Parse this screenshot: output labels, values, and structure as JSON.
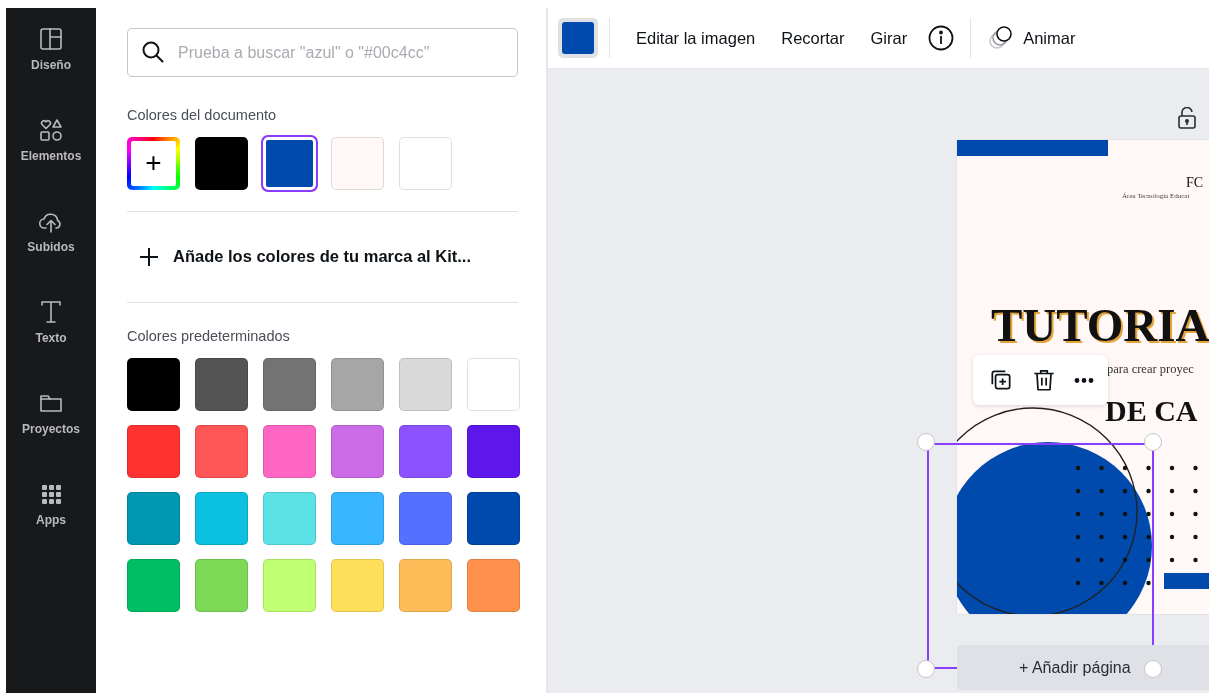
{
  "sidebar": {
    "items": [
      {
        "label": "Diseño"
      },
      {
        "label": "Elementos"
      },
      {
        "label": "Subidos"
      },
      {
        "label": "Texto"
      },
      {
        "label": "Proyectos"
      },
      {
        "label": "Apps"
      }
    ]
  },
  "panel": {
    "search": {
      "placeholder": "Prueba a buscar \"azul\" o \"#00c4cc\""
    },
    "document_colors": {
      "title": "Colores del documento",
      "swatches": [
        {
          "kind": "add",
          "label": "+"
        },
        {
          "kind": "color",
          "color": "#000000",
          "selected": false
        },
        {
          "kind": "color",
          "color": "#004aad",
          "selected": true
        },
        {
          "kind": "color",
          "color": "#fff8f7",
          "selected": false
        },
        {
          "kind": "color",
          "color": "#ffffff",
          "selected": false
        }
      ]
    },
    "brand_link": "Añade los colores de tu marca al Kit...",
    "default_colors": {
      "title": "Colores predeterminados",
      "swatches": [
        {
          "color": "#000000"
        },
        {
          "color": "#545454"
        },
        {
          "color": "#737373"
        },
        {
          "color": "#a6a6a6"
        },
        {
          "color": "#d9d9d9"
        },
        {
          "color": "#ffffff"
        },
        {
          "color": "#ff3131"
        },
        {
          "color": "#ff5757"
        },
        {
          "color": "#ff66c4"
        },
        {
          "color": "#cb6ce6"
        },
        {
          "color": "#8c52ff"
        },
        {
          "color": "#5e17eb"
        },
        {
          "color": "#0097b2"
        },
        {
          "color": "#0cc0df"
        },
        {
          "color": "#5ce1e6"
        },
        {
          "color": "#38b6ff"
        },
        {
          "color": "#5271ff"
        },
        {
          "color": "#004aad"
        },
        {
          "color": "#00bf63"
        },
        {
          "color": "#7ed957"
        },
        {
          "color": "#c1ff72"
        },
        {
          "color": "#ffde59"
        },
        {
          "color": "#ffbd59"
        },
        {
          "color": "#ff914d"
        }
      ]
    }
  },
  "toolbar": {
    "fill_swatch": {
      "color": "#004aad"
    },
    "buttons": [
      "Editar la imagen",
      "Recortar",
      "Girar"
    ],
    "animate": "Animar"
  },
  "canvas": {
    "design": {
      "org": "FC",
      "org_subtitle": "Área Tecnología Educat",
      "title": "TUTORIA",
      "subtitle": "para crear proyec",
      "title_line_2": "DE CA"
    },
    "add_page": "+ Añadir página"
  }
}
